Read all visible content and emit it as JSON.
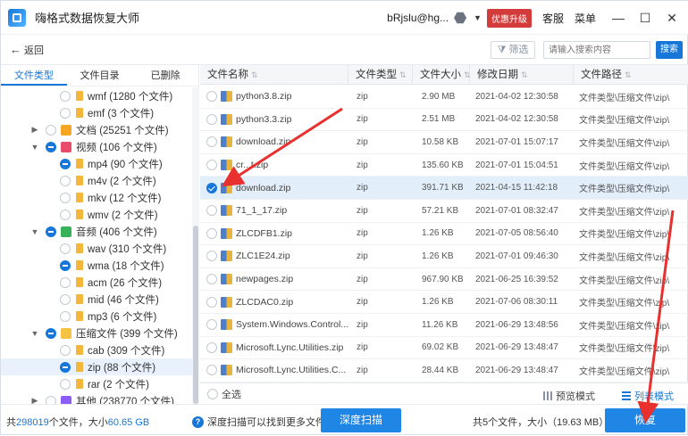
{
  "app": {
    "title": "嗨格式数据恢复大师",
    "user": "bRjslu@hg...",
    "vip_label": "优惠升级",
    "service_label": "客服",
    "menu_label": "菜单",
    "minimize": "—",
    "maximize": "☐",
    "close": "✕"
  },
  "toolbar": {
    "back_label": "返回",
    "filter_label": "筛选",
    "search_placeholder": "请输入搜索内容",
    "search_button": "搜索"
  },
  "sidebar": {
    "tabs": [
      {
        "label": "文件类型"
      },
      {
        "label": "文件目录"
      },
      {
        "label": "已删除"
      }
    ],
    "tree": [
      {
        "label": "wmf (1280 个文件)"
      },
      {
        "label": "emf (3 个文件)"
      },
      {
        "label": "文档 (25251 个文件)"
      },
      {
        "label": "视频 (106 个文件)"
      },
      {
        "label": "mp4 (90 个文件)"
      },
      {
        "label": "m4v (2 个文件)"
      },
      {
        "label": "mkv (12 个文件)"
      },
      {
        "label": "wmv (2 个文件)"
      },
      {
        "label": "音频 (406 个文件)"
      },
      {
        "label": "wav (310 个文件)"
      },
      {
        "label": "wma (18 个文件)"
      },
      {
        "label": "acm (26 个文件)"
      },
      {
        "label": "mid (46 个文件)"
      },
      {
        "label": "mp3 (6 个文件)"
      },
      {
        "label": "压缩文件 (399 个文件)"
      },
      {
        "label": "cab (309 个文件)"
      },
      {
        "label": "zip (88 个文件)"
      },
      {
        "label": "rar (2 个文件)"
      },
      {
        "label": "其他 (238770 个文件)"
      }
    ]
  },
  "table": {
    "columns": [
      {
        "label": "文件名称"
      },
      {
        "label": "文件类型"
      },
      {
        "label": "文件大小"
      },
      {
        "label": "修改日期"
      },
      {
        "label": "文件路径"
      }
    ],
    "rows": [
      {
        "name": "python3.8.zip",
        "type": "zip",
        "size": "2.90 MB",
        "date": "2021-04-02 12:30:58",
        "path": "文件类型\\压缩文件\\zip\\"
      },
      {
        "name": "python3.3.zip",
        "type": "zip",
        "size": "2.51 MB",
        "date": "2021-04-02 12:30:58",
        "path": "文件类型\\压缩文件\\zip\\"
      },
      {
        "name": "download.zip",
        "type": "zip",
        "size": "10.58 KB",
        "date": "2021-07-01 15:07:17",
        "path": "文件类型\\压缩文件\\zip\\"
      },
      {
        "name": "cr...t.zip",
        "type": "zip",
        "size": "135.60 KB",
        "date": "2021-07-01 15:04:51",
        "path": "文件类型\\压缩文件\\zip\\"
      },
      {
        "name": "download.zip",
        "type": "zip",
        "size": "391.71 KB",
        "date": "2021-04-15 11:42:18",
        "path": "文件类型\\压缩文件\\zip\\"
      },
      {
        "name": "71_1_17.zip",
        "type": "zip",
        "size": "57.21 KB",
        "date": "2021-07-01 08:32:47",
        "path": "文件类型\\压缩文件\\zip\\"
      },
      {
        "name": "ZLCDFB1.zip",
        "type": "zip",
        "size": "1.26 KB",
        "date": "2021-07-05 08:56:40",
        "path": "文件类型\\压缩文件\\zip\\"
      },
      {
        "name": "ZLC1E24.zip",
        "type": "zip",
        "size": "1.26 KB",
        "date": "2021-07-01 09:46:30",
        "path": "文件类型\\压缩文件\\zip\\"
      },
      {
        "name": "newpages.zip",
        "type": "zip",
        "size": "967.90 KB",
        "date": "2021-06-25 16:39:52",
        "path": "文件类型\\压缩文件\\zip\\"
      },
      {
        "name": "ZLCDAC0.zip",
        "type": "zip",
        "size": "1.26 KB",
        "date": "2021-07-06 08:30:11",
        "path": "文件类型\\压缩文件\\zip\\"
      },
      {
        "name": "System.Windows.Control...",
        "type": "zip",
        "size": "11.26 KB",
        "date": "2021-06-29 13:48:56",
        "path": "文件类型\\压缩文件\\zip\\"
      },
      {
        "name": "Microsoft.Lync.Utilities.zip",
        "type": "zip",
        "size": "69.02 KB",
        "date": "2021-06-29 13:48:47",
        "path": "文件类型\\压缩文件\\zip\\"
      },
      {
        "name": "Microsoft.Lync.Utilities.C...",
        "type": "zip",
        "size": "28.44 KB",
        "date": "2021-06-29 13:48:47",
        "path": "文件类型\\压缩文件\\zip\\"
      }
    ],
    "select_all_label": "全选",
    "preview_mode_label": "预览模式",
    "list_mode_label": "列表模式"
  },
  "status": {
    "total_prefix": "共",
    "total_count": "298019",
    "total_mid": "个文件，大小",
    "total_size": "60.65 GB",
    "tip": "深度扫描可以找到更多文件",
    "deep_scan_label": "深度扫描",
    "selected_text": "共5个文件，大小（19.63 MB）",
    "recover_label": "恢复"
  },
  "colors": {
    "accent": "#1677d9",
    "vip": "#d43b3b",
    "annotation": "#e8312f"
  }
}
